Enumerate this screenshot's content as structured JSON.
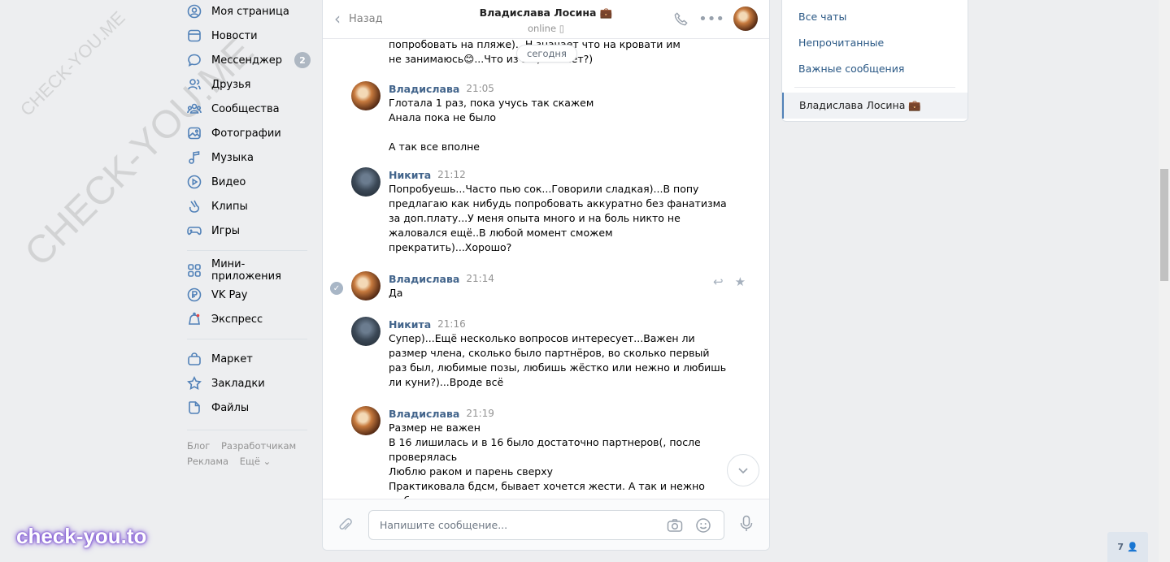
{
  "nav": {
    "items": [
      {
        "label": "Моя страница",
        "icon": "user-icon"
      },
      {
        "label": "Новости",
        "icon": "news-icon"
      },
      {
        "label": "Мессенджер",
        "icon": "messenger-icon",
        "badge": "2"
      },
      {
        "label": "Друзья",
        "icon": "friends-icon"
      },
      {
        "label": "Сообщества",
        "icon": "communities-icon"
      },
      {
        "label": "Фотографии",
        "icon": "photos-icon"
      },
      {
        "label": "Музыка",
        "icon": "music-icon"
      },
      {
        "label": "Видео",
        "icon": "video-icon"
      },
      {
        "label": "Клипы",
        "icon": "clips-icon"
      },
      {
        "label": "Игры",
        "icon": "games-icon"
      }
    ],
    "items2": [
      {
        "label": "Мини-приложения",
        "icon": "mini-apps-icon"
      },
      {
        "label": "VK Pay",
        "icon": "vkpay-icon"
      },
      {
        "label": "Экспресс",
        "icon": "express-icon"
      }
    ],
    "items3": [
      {
        "label": "Маркет",
        "icon": "market-icon"
      },
      {
        "label": "Закладки",
        "icon": "bookmarks-icon"
      },
      {
        "label": "Файлы",
        "icon": "files-icon"
      }
    ],
    "footer": {
      "blog": "Блог",
      "dev": "Разработчикам",
      "ads": "Реклама",
      "more": "Ещё ⌄"
    }
  },
  "chat": {
    "back": "Назад",
    "peer_name": "Владислава Лосина 💼",
    "peer_status": "online ▯",
    "date_pill": "сегодня",
    "partial_top": "попробовать на пляже)...Н           значает что на кровати им\nне занимаюсь😊...Что из                шь, что нет?)",
    "messages": [
      {
        "author": "Владислава",
        "time": "21:05",
        "text": "Глотала 1 раз, пока учусь так скажем\nАнала пока не было\n\nА так все вполне"
      },
      {
        "author": "Никита",
        "time": "21:12",
        "text": "Попробуешь...Часто пью сок...Говорили сладкая)...В попу\nпредлагаю как нибудь попробовать аккуратно без фанатизма\nза доп.плату...У меня опыта много и на боль никто не\nжаловался ещё..В любой момент сможем\nпрекратить)...Хорошо?"
      },
      {
        "author": "Владислава",
        "time": "21:14",
        "text": "Да"
      },
      {
        "author": "Никита",
        "time": "21:16",
        "text": "Супер)...Ещё несколько вопросов интересует...Важен ли\nразмер члена, сколько было партнёров, во сколько первый\nраз был, любимые позы, любишь жёстко или нежно и любишь\nли куни?)...Вроде всё"
      },
      {
        "author": "Владислава",
        "time": "21:19",
        "text": "Размер не важен\nВ 16 лишилась и в 16 было достаточно партнеров(, после\nпроверялась\nЛюблю раком и парень сверху\nПрактиковала бдсм, бывает хочется жести. А так и нежно\nлюблю"
      }
    ],
    "composer_placeholder": "Напишите сообщение..."
  },
  "right_panel": {
    "all_chats": "Все чаты",
    "unread": "Непрочитанные",
    "important": "Важные сообщения",
    "active_chat": "Владислава Лосина 💼"
  },
  "online_count": "7",
  "watermark_big": "CHECK-YOU.ME",
  "watermark_small": "CHECK-YOU.ME",
  "brand": "check-you.to"
}
